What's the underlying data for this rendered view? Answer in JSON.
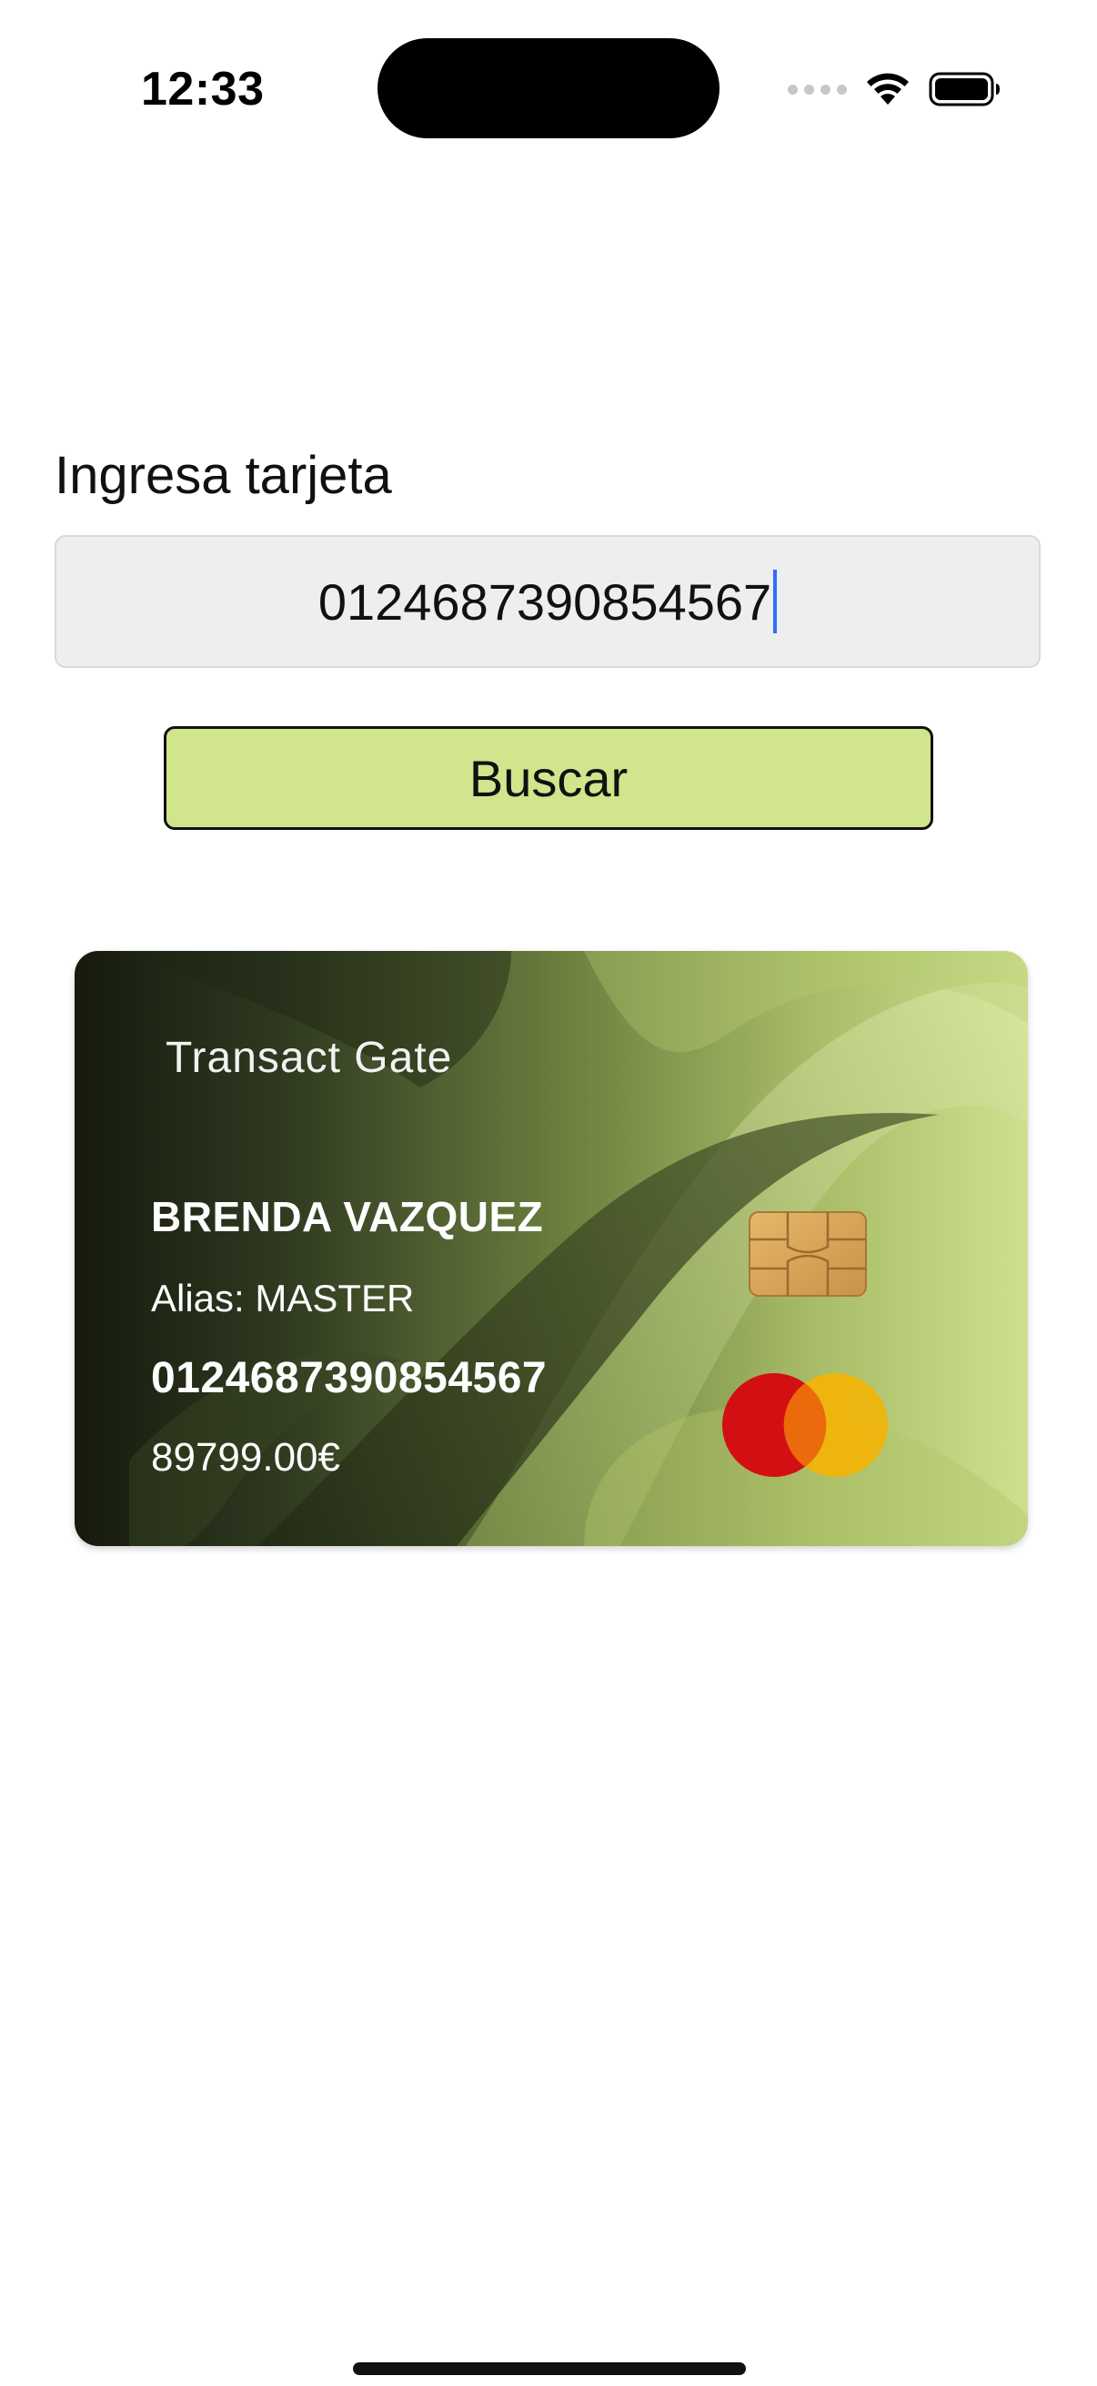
{
  "status_bar": {
    "time": "12:33"
  },
  "form": {
    "label": "Ingresa tarjeta",
    "card_input_value": "0124687390854567",
    "search_button_label": "Buscar"
  },
  "card": {
    "brand": "Transact Gate",
    "holder_name": "BRENDA VAZQUEZ",
    "alias_label": "Alias:",
    "alias_value": "MASTER",
    "number": "0124687390854567",
    "balance": "89799.00€",
    "network_icon": "mastercard-logo",
    "chip_icon": "emv-chip-icon"
  },
  "colors": {
    "button_fill": "#d0e58c",
    "input_fill": "#eeeeee",
    "caret": "#2f6bff",
    "card_dark": "#1a1e12",
    "card_light": "#c8dc86"
  }
}
